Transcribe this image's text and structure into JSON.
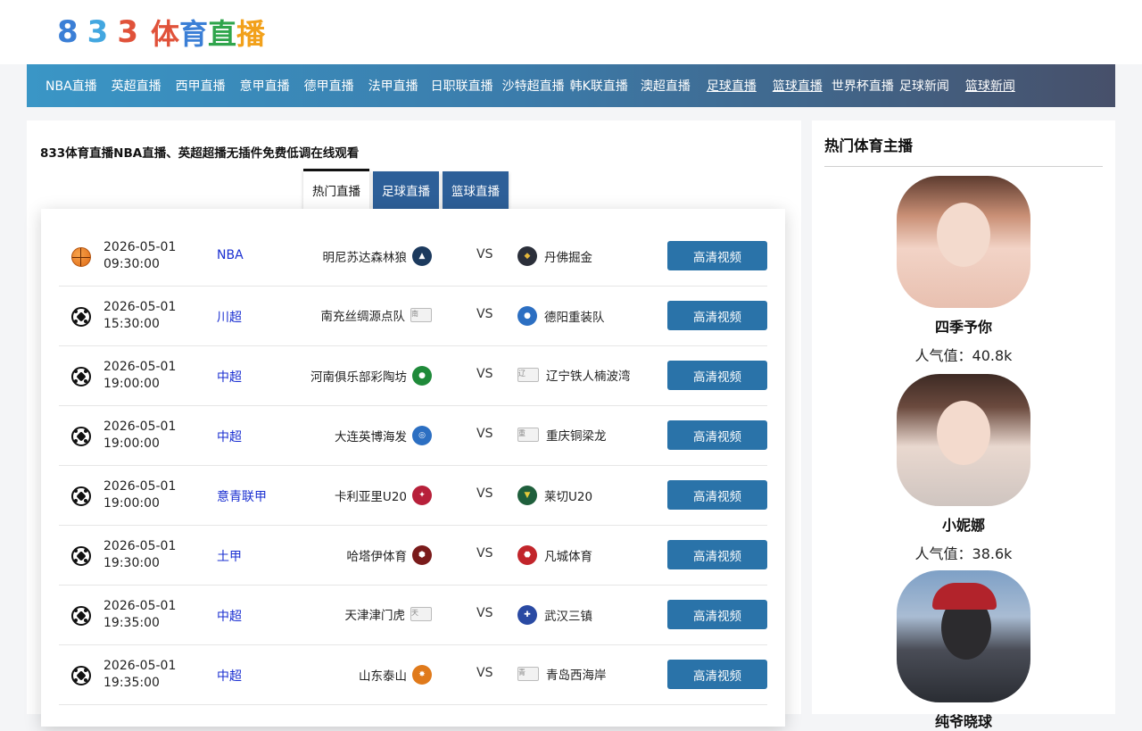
{
  "logo": {
    "digits": [
      "8",
      "3",
      "3"
    ],
    "text": [
      "体",
      "育",
      "直",
      "播"
    ]
  },
  "nav": [
    {
      "label": "NBA直播"
    },
    {
      "label": "英超直播"
    },
    {
      "label": "西甲直播"
    },
    {
      "label": "意甲直播"
    },
    {
      "label": "德甲直播"
    },
    {
      "label": "法甲直播"
    },
    {
      "label": "日职联直播"
    },
    {
      "label": "沙特超直播"
    },
    {
      "label": "韩K联直播"
    },
    {
      "label": "澳超直播"
    },
    {
      "label": "足球直播"
    },
    {
      "label": "篮球直播"
    },
    {
      "label": "世界杯直播"
    },
    {
      "label": "足球新闻"
    },
    {
      "label": "篮球新闻"
    }
  ],
  "main": {
    "headline": "833体育直播NBA直播、英超超播无插件免费低调在线观看",
    "tabs": [
      {
        "label": "热门直播"
      },
      {
        "label": "足球直播"
      },
      {
        "label": "篮球直播"
      }
    ]
  },
  "matches": [
    {
      "sport": "basketball-icon",
      "date": "2026-05-01",
      "time": "09:30:00",
      "league": "NBA",
      "home": "明尼苏达森林狼",
      "vs": "VS",
      "away": "丹佛掘金",
      "button": "高清视频",
      "home_logo_color": "#1c3a5e",
      "away_logo_color": "#2b2f3a"
    },
    {
      "sport": "soccer-icon",
      "date": "2026-05-01",
      "time": "15:30:00",
      "league": "川超",
      "home": "南充丝绸源点队",
      "vs": "VS",
      "away": "德阳重装队",
      "button": "高清视频",
      "home_logo_alt": "南",
      "away_logo_color": "#2c6fc2"
    },
    {
      "sport": "soccer-icon",
      "date": "2026-05-01",
      "time": "19:00:00",
      "league": "中超",
      "home": "河南俱乐部彩陶坊",
      "vs": "VS",
      "away": "辽宁铁人楠波湾",
      "button": "高清视频",
      "home_logo_color": "#1f8a3a",
      "away_logo_alt": "辽"
    },
    {
      "sport": "soccer-icon",
      "date": "2026-05-01",
      "time": "19:00:00",
      "league": "中超",
      "home": "大连英博海发",
      "vs": "VS",
      "away": "重庆铜梁龙",
      "button": "高清视频",
      "home_logo_color": "#2c6fc2",
      "away_logo_alt": "重"
    },
    {
      "sport": "soccer-icon",
      "date": "2026-05-01",
      "time": "19:00:00",
      "league": "意青联甲",
      "home": "卡利亚里U20",
      "vs": "VS",
      "away": "莱切U20",
      "button": "高清视频",
      "home_logo_color": "#b7203a",
      "away_logo_color": "#1f5f3c"
    },
    {
      "sport": "soccer-icon",
      "date": "2026-05-01",
      "time": "19:30:00",
      "league": "土甲",
      "home": "哈塔伊体育",
      "vs": "VS",
      "away": "凡城体育",
      "button": "高清视频",
      "home_logo_color": "#7a1b1b",
      "away_logo_color": "#c2252b"
    },
    {
      "sport": "soccer-icon",
      "date": "2026-05-01",
      "time": "19:35:00",
      "league": "中超",
      "home": "天津津门虎",
      "vs": "VS",
      "away": "武汉三镇",
      "button": "高清视频",
      "home_logo_alt": "天",
      "away_logo_color": "#2a4aa3"
    },
    {
      "sport": "soccer-icon",
      "date": "2026-05-01",
      "time": "19:35:00",
      "league": "中超",
      "home": "山东泰山",
      "vs": "VS",
      "away": "青岛西海岸",
      "button": "高清视频",
      "home_logo_color": "#e07a1b",
      "away_logo_alt": "青"
    }
  ],
  "sidebar": {
    "title": "热门体育主播",
    "hosts": [
      {
        "name": "四季予你",
        "popularity": "人气值：40.8k"
      },
      {
        "name": "小妮娜",
        "popularity": "人气值：38.6k"
      },
      {
        "name": "纯爷晓球",
        "popularity": ""
      }
    ]
  }
}
